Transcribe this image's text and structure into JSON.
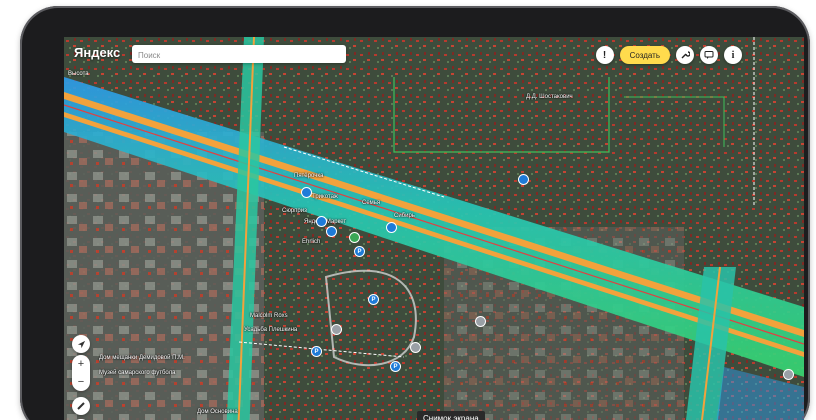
{
  "app": {
    "logo": "Яндекс"
  },
  "search": {
    "placeholder": "Поиск"
  },
  "toolbar": {
    "create_label": "Создать",
    "alert_glyph": "!",
    "info_glyph": "i"
  },
  "map": {
    "height_tag": "Высота",
    "labels": [
      "Д.Д. Шостакович",
      "Пятёрочка",
      "Трикотаж",
      "Сюрприз",
      "Яндекс Маркет",
      "Семья",
      "Сибирь",
      "Ehrlich",
      "Malcolm Roxs",
      "Усадьба Плешкина",
      "Дом мещанки Демидовой П.М.",
      "Музей самарского футбола",
      "Дом Основина"
    ]
  },
  "controls": {
    "zoom_in": "+",
    "zoom_out": "−"
  },
  "tooltip": {
    "text": "Снимок экрана"
  },
  "colors": {
    "accent": "#ffdb4d",
    "pin": "#1e7bd8"
  }
}
